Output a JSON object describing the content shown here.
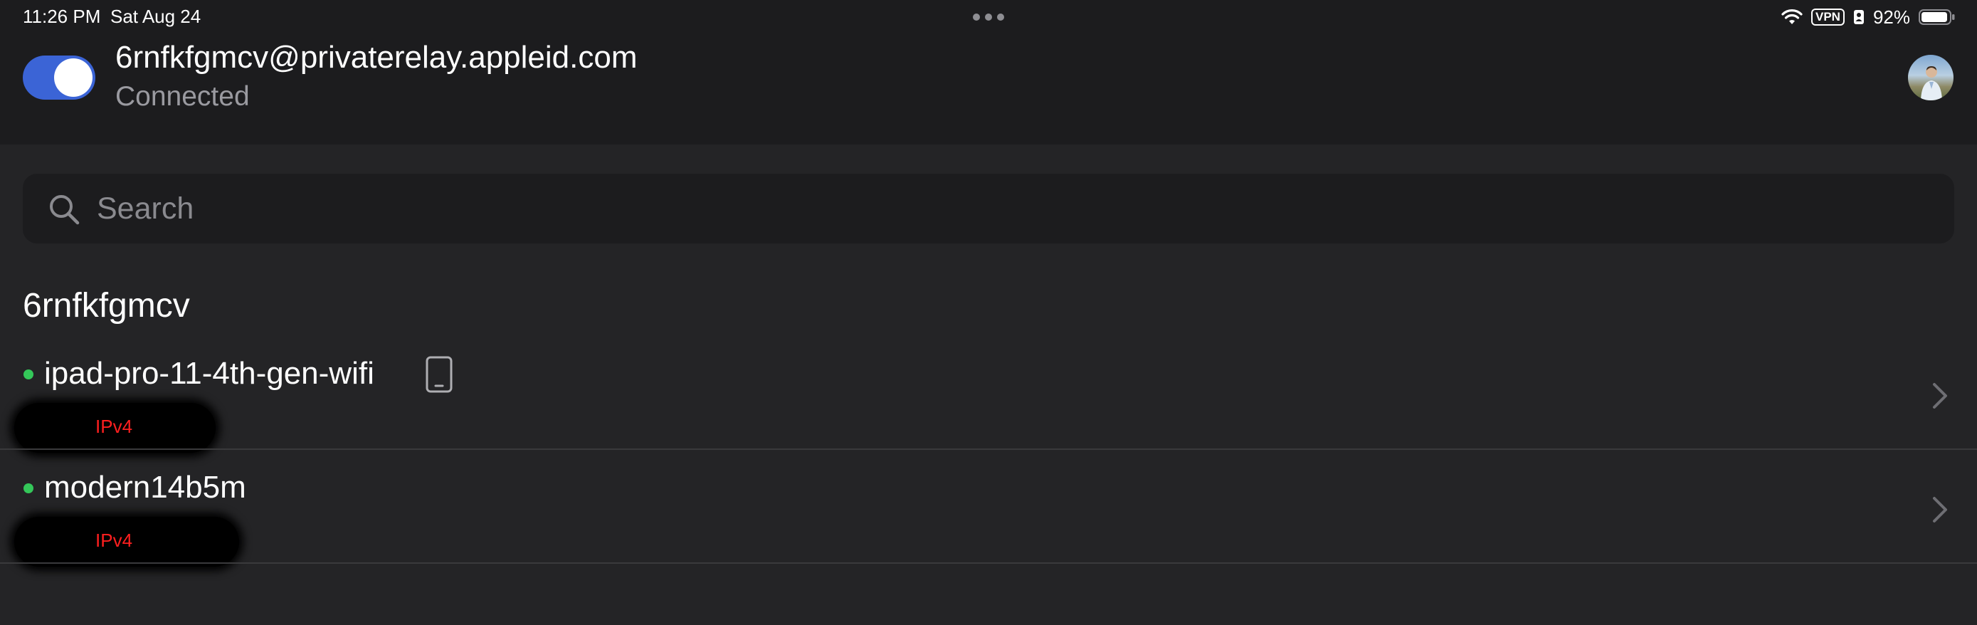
{
  "status_bar": {
    "time": "11:26 PM",
    "date": "Sat Aug 24",
    "vpn": "VPN",
    "battery": "92%",
    "icons": [
      "wifi-icon",
      "vpn-icon",
      "person-badge-icon",
      "battery-icon"
    ]
  },
  "header": {
    "toggle": "on",
    "account_email": "6rnfkfgmcv@privaterelay.appleid.com",
    "connection_status": "Connected"
  },
  "search": {
    "placeholder": "Search",
    "value": ""
  },
  "section": {
    "title": "6rnfkfgmcv"
  },
  "devices": [
    {
      "name": "ipad-pro-11-4th-gen-wifi",
      "online": true,
      "ip_label": "IPv4",
      "icon": "tablet-icon"
    },
    {
      "name": "modern14b5m",
      "online": true,
      "ip_label": "IPv4"
    }
  ],
  "colors": {
    "accent": "#3b64d6",
    "online": "#34c759",
    "ip_label": "#ff1f1f",
    "background": "#242426",
    "header_bg": "#1c1c1e"
  }
}
